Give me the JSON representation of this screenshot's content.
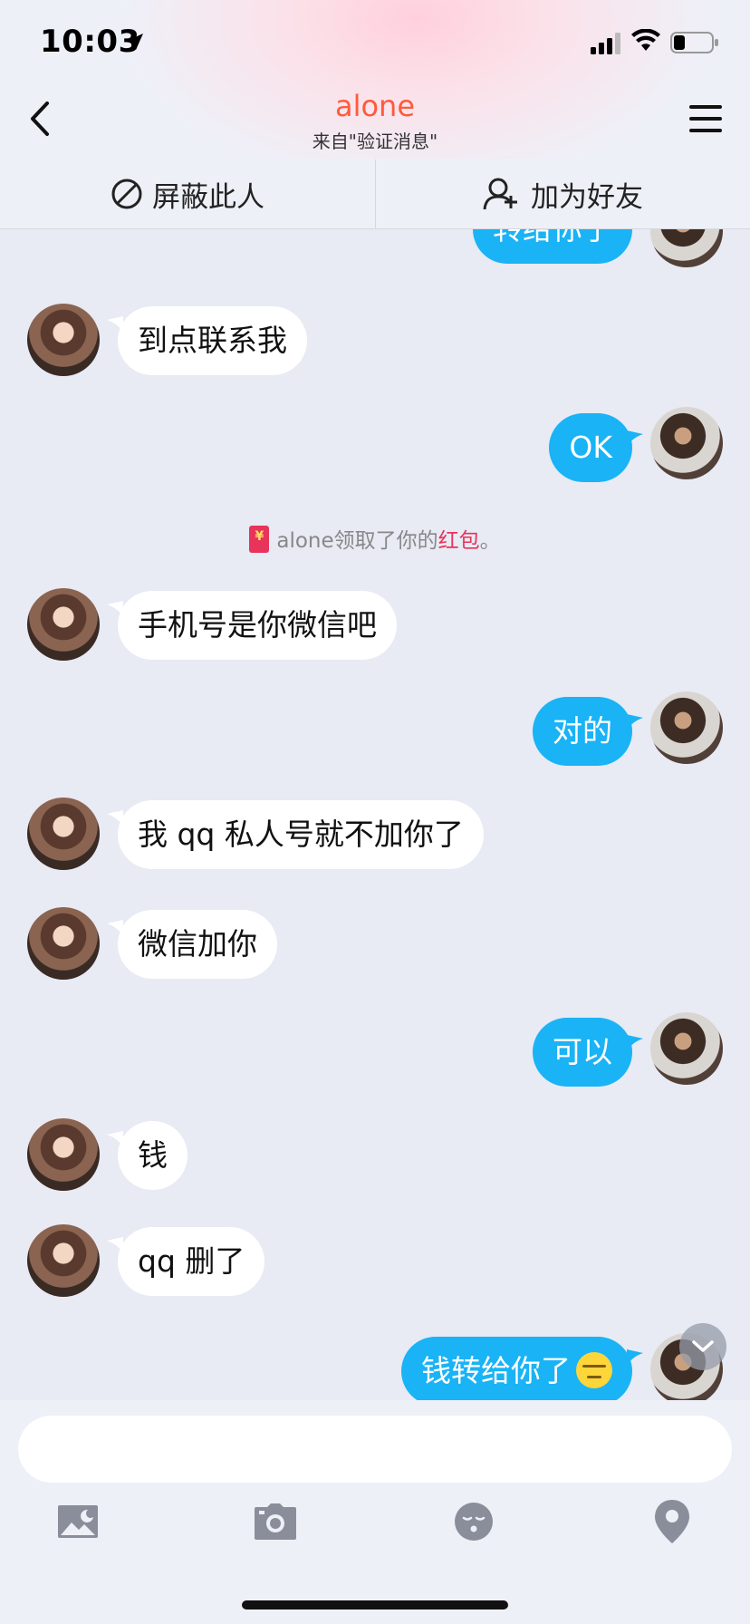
{
  "status_bar": {
    "time": "10:03"
  },
  "header": {
    "title": "alone",
    "subtitle": "来自\"验证消息\""
  },
  "actions": {
    "block_label": "屏蔽此人",
    "add_friend_label": "加为好友"
  },
  "messages": [
    {
      "side": "right",
      "text": "转给你了"
    },
    {
      "side": "left",
      "text": "到点联系我"
    },
    {
      "side": "right",
      "text": "OK"
    },
    {
      "side": "left",
      "text": "手机号是你微信吧"
    },
    {
      "side": "right",
      "text": "对的"
    },
    {
      "side": "left",
      "text": "我 qq 私人号就不加你了"
    },
    {
      "side": "left",
      "text": "微信加你"
    },
    {
      "side": "right",
      "text": "可以"
    },
    {
      "side": "left",
      "text": "钱"
    },
    {
      "side": "left",
      "text": "qq 删了"
    },
    {
      "side": "right",
      "text": "钱转给你了"
    }
  ],
  "system_note": {
    "name": "alone",
    "text": "领取了你的",
    "highlight": "红包",
    "end": "。"
  },
  "colors": {
    "accent_title": "#ff5a3c",
    "bubble_self": "#1ab3f5",
    "bubble_other": "#ffffff",
    "highlight": "#e8335a"
  },
  "toolbar_icons": [
    "image-icon",
    "camera-icon",
    "emoji-icon",
    "location-icon"
  ]
}
